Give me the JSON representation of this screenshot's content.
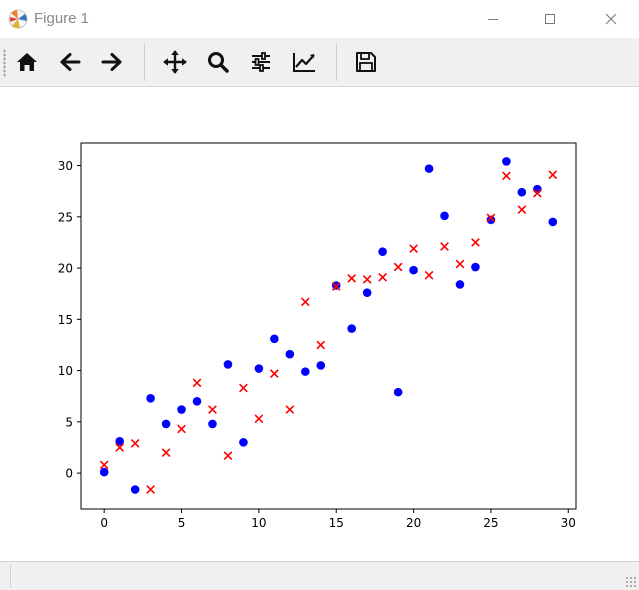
{
  "window": {
    "title": "Figure 1",
    "icon": "matplotlib-logo-icon",
    "controls": [
      "minimize-icon",
      "maximize-icon",
      "close-icon"
    ]
  },
  "toolbar": {
    "tools": [
      {
        "name": "home",
        "icon": "home-icon"
      },
      {
        "name": "back",
        "icon": "arrow-left-icon"
      },
      {
        "name": "forward",
        "icon": "arrow-right-icon"
      },
      {
        "name": "pan",
        "icon": "move-icon"
      },
      {
        "name": "zoom",
        "icon": "zoom-icon"
      },
      {
        "name": "subplots",
        "icon": "sliders-icon"
      },
      {
        "name": "customize",
        "icon": "line-chart-icon"
      },
      {
        "name": "save",
        "icon": "save-icon"
      }
    ]
  },
  "colors": {
    "series_a": "#0000ff",
    "series_b": "#ff0000",
    "toolbar_bg": "#f0f0f0"
  },
  "chart_data": {
    "type": "scatter",
    "title": "",
    "xlabel": "",
    "ylabel": "",
    "xlim": [
      -1.5,
      30.5
    ],
    "ylim": [
      -3.5,
      32.2
    ],
    "xticks": [
      0,
      5,
      10,
      15,
      20,
      25,
      30
    ],
    "yticks": [
      0,
      5,
      10,
      15,
      20,
      25,
      30
    ],
    "grid": false,
    "legend": "none",
    "series": [
      {
        "marker": "circle",
        "color": "#0000ff",
        "x": [
          0,
          1,
          2,
          3,
          4,
          5,
          6,
          7,
          8,
          9,
          10,
          11,
          12,
          13,
          14,
          15,
          16,
          17,
          18,
          19,
          20,
          21,
          22,
          23,
          24,
          25,
          26,
          27,
          28,
          29
        ],
        "y": [
          0.1,
          3.1,
          -1.6,
          7.3,
          4.8,
          6.2,
          7.0,
          4.8,
          10.6,
          3.0,
          10.2,
          13.1,
          11.6,
          9.9,
          10.5,
          18.3,
          14.1,
          17.6,
          21.6,
          7.9,
          19.8,
          29.7,
          25.1,
          18.4,
          20.1,
          24.7,
          30.4,
          27.4,
          27.7,
          24.5
        ]
      },
      {
        "marker": "x",
        "color": "#ff0000",
        "x": [
          0,
          1,
          2,
          3,
          4,
          5,
          6,
          7,
          8,
          9,
          10,
          11,
          12,
          13,
          14,
          15,
          16,
          17,
          18,
          19,
          20,
          21,
          22,
          23,
          24,
          25,
          26,
          27,
          28,
          29
        ],
        "y": [
          0.8,
          2.5,
          2.9,
          -1.6,
          2.0,
          4.3,
          8.8,
          6.2,
          1.7,
          8.3,
          5.3,
          9.7,
          6.2,
          16.7,
          12.5,
          18.2,
          19.0,
          18.9,
          19.1,
          20.1,
          21.9,
          19.3,
          22.1,
          20.4,
          22.5,
          24.9,
          29.0,
          25.7,
          27.3,
          29.1
        ]
      }
    ]
  }
}
